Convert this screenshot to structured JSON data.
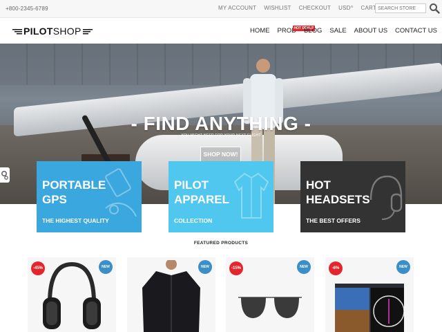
{
  "topbar": {
    "phone": "+800-2345-6789",
    "links": [
      "MY ACCOUNT",
      "WISHLIST",
      "CHECKOUT",
      "USD^",
      "CART 0"
    ],
    "search_placeholder": "SEARCH STORE",
    "search_icon": "search-icon"
  },
  "header": {
    "logo_bold": "PILOT",
    "logo_light": "SHOP",
    "nav": [
      "HOME",
      "PROD",
      "BLOG",
      "SALE",
      "ABOUT US",
      "CONTACT US"
    ],
    "hot_badge": "HOT DEALS"
  },
  "hero": {
    "title": "- FIND ANYTHING -",
    "subtitle": "YOU MIGHT NEED FOR YOUR NEXT FLIGHT",
    "button": "SHOP NOW!"
  },
  "categories": [
    {
      "title_l1": "PORTABLE",
      "title_l2": "GPS",
      "sub": "THE HIGHEST QUALITY",
      "color": "#3aa8de",
      "icon": "gps-device-icon"
    },
    {
      "title_l1": "PILOT",
      "title_l2": "APPAREL",
      "sub": "COLLECTION",
      "color": "#4fc7ee",
      "icon": "jacket-icon"
    },
    {
      "title_l1": "HOT",
      "title_l2": "HEADSETS",
      "sub": "THE BEST OFFERS",
      "color": "#333333",
      "icon": "headset-icon"
    }
  ],
  "featured": {
    "title": "FEATURED PRODUCTS",
    "products": [
      {
        "discount": "-45%",
        "badge": "NEW",
        "image": "aviation-headset"
      },
      {
        "discount": "",
        "badge": "NEW",
        "image": "bomber-jacket"
      },
      {
        "discount": "-15%",
        "badge": "NEW",
        "image": "aviator-sunglasses"
      },
      {
        "discount": "-6%",
        "badge": "NEW",
        "image": "avionics-display"
      }
    ]
  },
  "colors": {
    "accent_red": "#e3262b",
    "badge_blue": "#3a8fc7"
  }
}
